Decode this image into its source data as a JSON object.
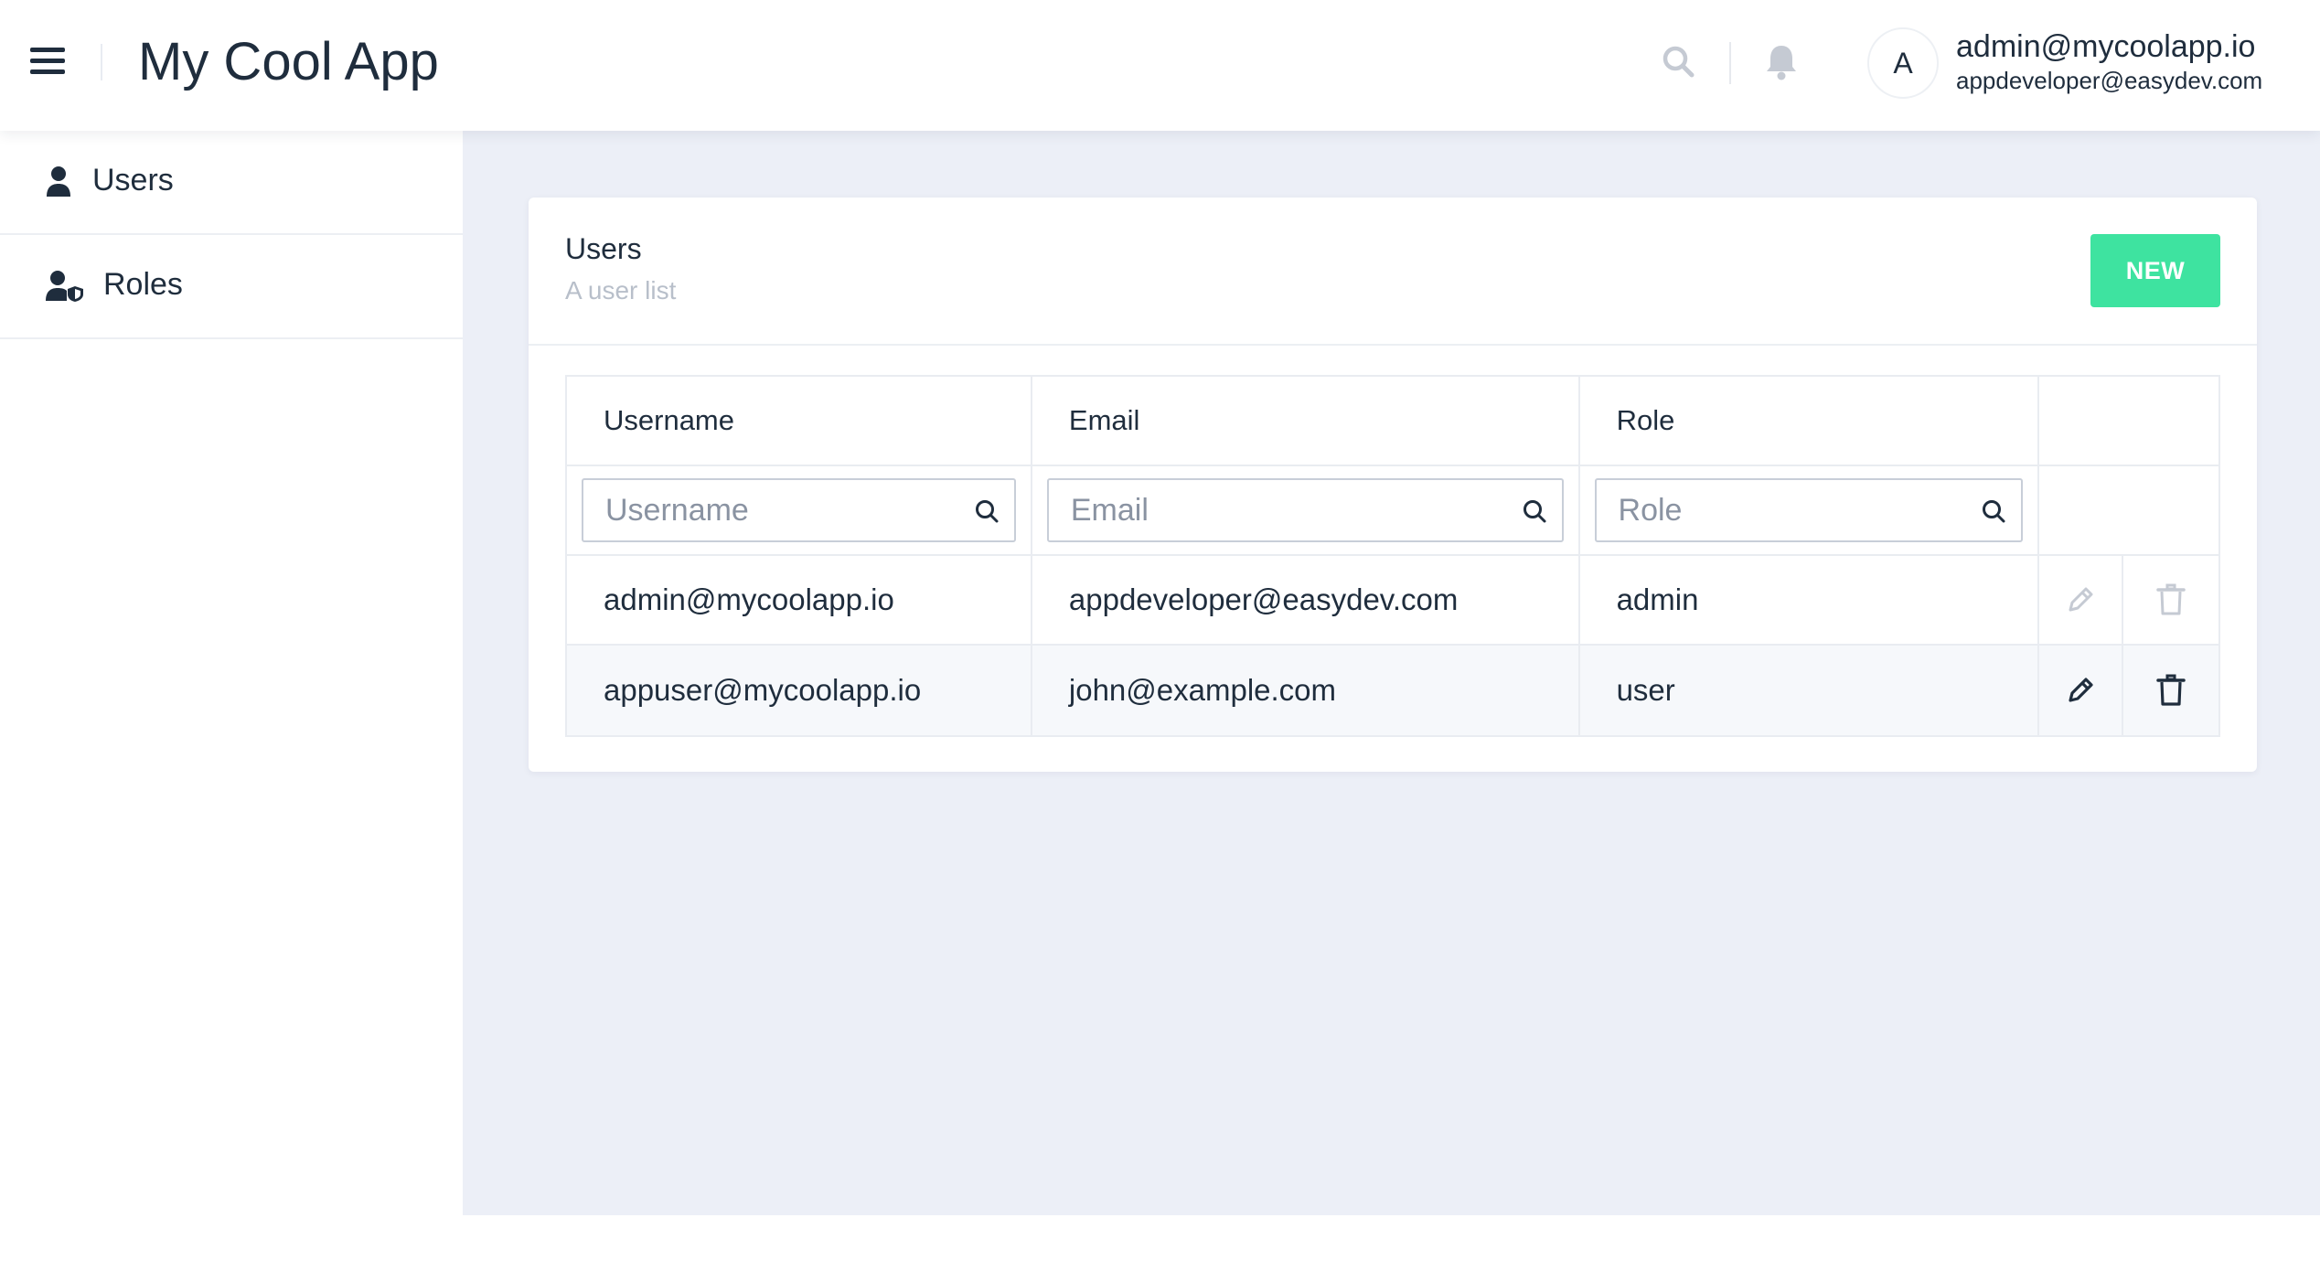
{
  "header": {
    "app_title": "My Cool App",
    "avatar_initial": "A",
    "user_primary": "admin@mycoolapp.io",
    "user_secondary": "appdeveloper@easydev.com",
    "icons": [
      "menu-icon",
      "search-icon",
      "bell-icon"
    ]
  },
  "sidebar": {
    "items": [
      {
        "label": "Users",
        "icon": "user-icon"
      },
      {
        "label": "Roles",
        "icon": "user-shield-icon"
      }
    ]
  },
  "card": {
    "title": "Users",
    "subtitle": "A user list",
    "new_button": "NEW"
  },
  "table": {
    "columns": [
      "Username",
      "Email",
      "Role"
    ],
    "filters": {
      "username_placeholder": "Username",
      "email_placeholder": "Email",
      "role_placeholder": "Role"
    },
    "rows": [
      {
        "username": "admin@mycoolapp.io",
        "email": "appdeveloper@easydev.com",
        "role": "admin",
        "actions_enabled": false
      },
      {
        "username": "appuser@mycoolapp.io",
        "email": "john@example.com",
        "role": "user",
        "actions_enabled": true
      }
    ]
  },
  "colors": {
    "accent_green": "#3ee3a0",
    "text_dark": "#1f2d3d",
    "content_bg": "#eceff7",
    "disabled_icon": "#c5cad3"
  }
}
